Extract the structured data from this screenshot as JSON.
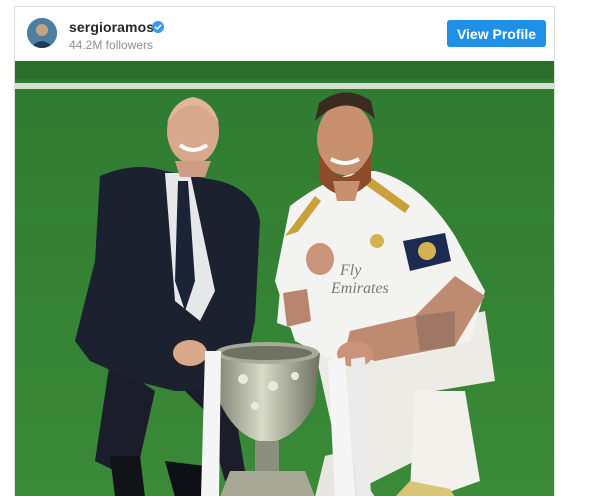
{
  "post": {
    "username": "sergioramos",
    "followers": "44.2M followers",
    "verified": true,
    "view_profile_label": "View Profile"
  },
  "photo": {
    "sponsor_text_line1": "Fly",
    "sponsor_text_line2": "Emirates"
  },
  "colors": {
    "button": "#1e90e8",
    "pitch": "#3f8a3a",
    "kit": "#f3f3f1",
    "suit": "#1b2030"
  },
  "icons": [
    "verified-badge-icon",
    "avatar"
  ]
}
